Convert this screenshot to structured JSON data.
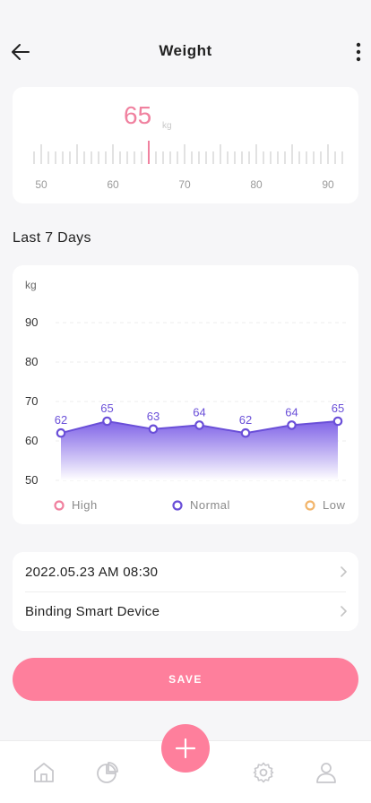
{
  "header": {
    "title": "Weight",
    "back_icon": "arrow-left-icon",
    "more_icon": "more-vertical-icon"
  },
  "weight": {
    "value": "65",
    "unit": "kg",
    "ruler_labels": [
      "50",
      "60",
      "70",
      "80",
      "90"
    ],
    "ruler_min": 50,
    "ruler_max": 92,
    "accent_color": "#f0819f"
  },
  "section": {
    "title": "Last 7 Days"
  },
  "chart_data": {
    "type": "area",
    "ylabel": "kg",
    "y_ticks": [
      "90",
      "80",
      "70",
      "60",
      "50"
    ],
    "ylim": [
      50,
      90
    ],
    "values": [
      62,
      65,
      63,
      64,
      62,
      64,
      65
    ],
    "value_labels": [
      "62",
      "65",
      "63",
      "64",
      "62",
      "64",
      "65"
    ],
    "grid": true,
    "series_color": "#6a4fd8",
    "legend": [
      {
        "label": "High",
        "color": "#f0819f"
      },
      {
        "label": "Normal",
        "color": "#6a4fd8"
      },
      {
        "label": "Low",
        "color": "#f2b56b"
      }
    ]
  },
  "list": {
    "datetime": "2022.05.23 AM 08:30",
    "binding": "Binding Smart Device"
  },
  "save": {
    "label": "SAVE",
    "color": "#fe7f9c"
  },
  "tabbar": {
    "icons": [
      "home-icon",
      "pie-chart-icon",
      "plus-icon",
      "gear-icon",
      "user-icon"
    ]
  }
}
